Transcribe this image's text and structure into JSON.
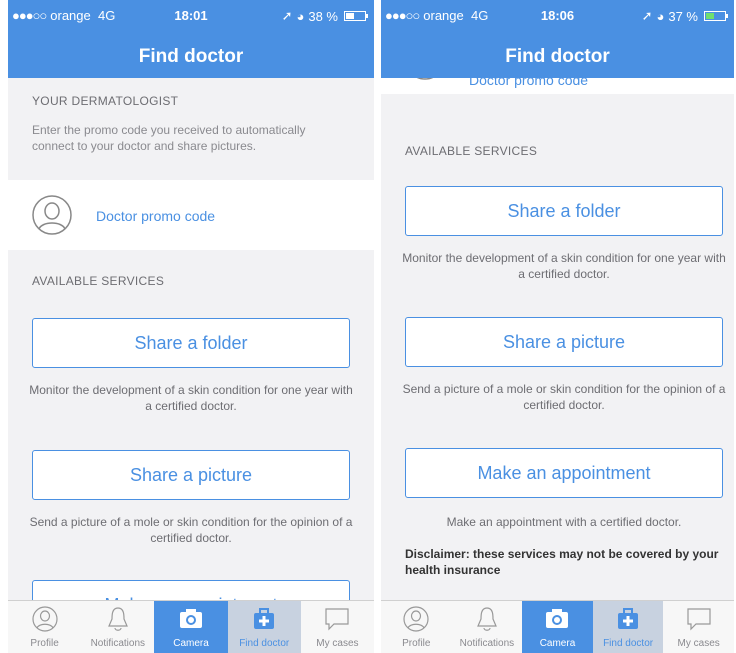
{
  "colors": {
    "accent": "#4a90e2",
    "background": "#f2f2f4",
    "header_text": "#ffffff"
  },
  "screens": [
    {
      "status": {
        "carrier": "orange",
        "network": "4G",
        "time": "18:01",
        "battery": "38 %"
      },
      "title": "Find doctor",
      "dermatologist": {
        "heading": "YOUR DERMATOLOGIST",
        "desc": "Enter the promo code you received to automatically connect to your doctor and share pictures.",
        "promo_link": "Doctor promo code"
      },
      "services_heading": "AVAILABLE SERVICES",
      "services": [
        {
          "label": "Share a folder",
          "desc": "Monitor the development of a skin condition for one year with a certified doctor."
        },
        {
          "label": "Share a picture",
          "desc": "Send a picture of a mole or skin condition for the opinion of a certified doctor."
        },
        {
          "label": "Make an appointment"
        }
      ],
      "tabs": [
        "Profile",
        "Notifications",
        "Camera",
        "Find doctor",
        "My cases"
      ]
    },
    {
      "status": {
        "carrier": "orange",
        "network": "4G",
        "time": "18:06",
        "battery": "37 %"
      },
      "title": "Find doctor",
      "promo_link": "Doctor promo code",
      "services_heading": "AVAILABLE SERVICES",
      "services": [
        {
          "label": "Share a folder",
          "desc": "Monitor the development of a skin condition for one year with a certified doctor."
        },
        {
          "label": "Share a picture",
          "desc": "Send a picture of a mole or skin condition for the opinion of a certified doctor."
        },
        {
          "label": "Make an appointment",
          "desc": "Make an appointment with a certified doctor."
        }
      ],
      "disclaimer": "Disclaimer: these services may not be covered by your health insurance",
      "tabs": [
        "Profile",
        "Notifications",
        "Camera",
        "Find doctor",
        "My cases"
      ]
    }
  ]
}
